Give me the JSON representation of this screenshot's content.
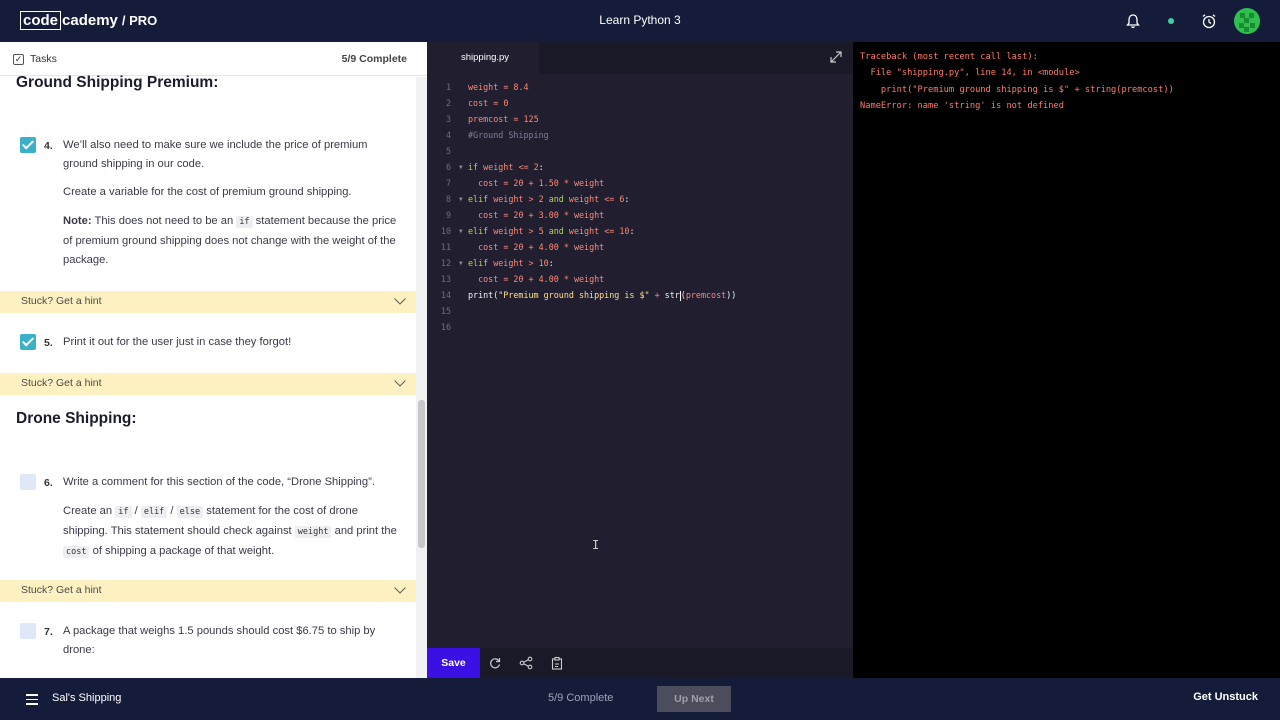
{
  "header": {
    "logo_code": "code",
    "logo_cademy": "cademy",
    "logo_pro": "/ PRO",
    "course_title": "Learn Python 3"
  },
  "tasks_panel": {
    "header_label": "Tasks",
    "progress": "5/9 Complete",
    "section1_title": "Ground Shipping Premium:",
    "section2_title": "Drone Shipping:",
    "hint_label": "Stuck? Get a hint",
    "task4": {
      "number": "4.",
      "line1": "We’ll also need to make sure we include the price of premium ground shipping in our code.",
      "line2": "Create a variable for the cost of premium ground shipping.",
      "note_label": "Note:",
      "note_pre": " This does not need to be an ",
      "note_code": "if",
      "note_post": " statement because the price of premium ground shipping does not change with the weight of the package."
    },
    "task5": {
      "number": "5.",
      "text": "Print it out for the user just in case they forgot!"
    },
    "task6": {
      "number": "6.",
      "line1": "Write a comment for this section of the code, “Drone Shipping”.",
      "p_a": "Create an ",
      "code_if": "if",
      "sep1": " / ",
      "code_elif": "elif",
      "sep2": " / ",
      "code_else": "else",
      "p_b": " statement for the cost of drone shipping. This statement should check against ",
      "code_weight": "weight",
      "p_c": " and print the ",
      "code_cost": "cost",
      "p_d": " of shipping a package of that weight."
    },
    "task7": {
      "number": "7.",
      "text": "A package that weighs 1.5 pounds should cost $6.75 to ship by drone:"
    }
  },
  "editor": {
    "filename": "shipping.py",
    "save_label": "Save"
  },
  "output": {
    "lines": [
      "Traceback (most recent call last):",
      "  File \"shipping.py\", line 14, in <module>",
      "    print(\"Premium ground shipping is $\" + string(premcost))",
      "NameError: name 'string' is not defined"
    ]
  },
  "footer": {
    "project_name": "Sal's Shipping",
    "progress": "5/9 Complete",
    "up_next": "Up Next",
    "get_unstuck": "Get Unstuck"
  },
  "colors": {
    "accent": "#3a10e5",
    "navbar": "#141c3a",
    "hint_bg": "#fdf1c2",
    "check_done": "#3bb0c9",
    "error_text": "#ff7b6b"
  },
  "icons": [
    "bell-icon",
    "status-dot-icon",
    "alarm-clock-icon",
    "avatar-icon",
    "expand-icon",
    "refresh-icon",
    "share-icon",
    "clipboard-icon",
    "menu-icon",
    "check-icon",
    "chevron-down-icon"
  ]
}
